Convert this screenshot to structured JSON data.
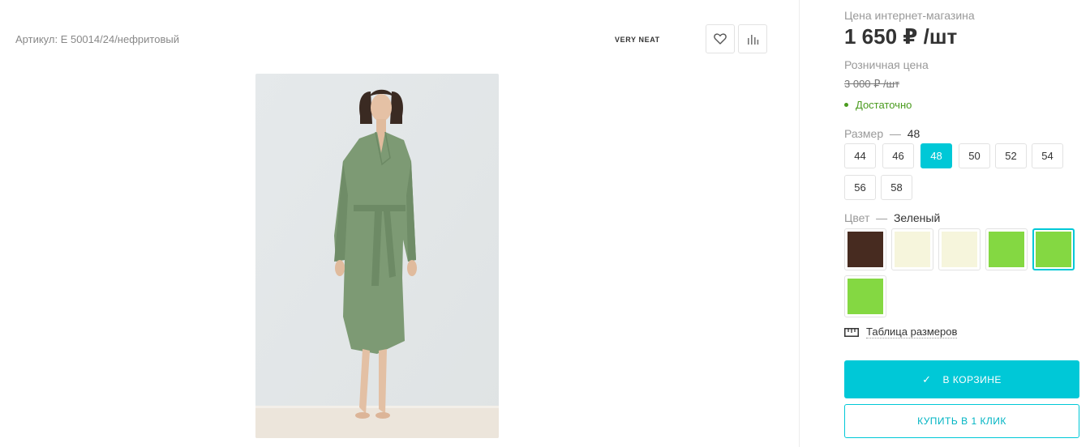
{
  "product": {
    "article": "Артикул: E 50014/24/нефритовый",
    "brand": "VERY NEAT"
  },
  "actions": {
    "favorite_icon": "heart-icon",
    "compare_icon": "bar-chart-icon"
  },
  "pricing": {
    "online_label": "Цена интернет-магазина",
    "online_price": "1 650 ₽ /шт",
    "retail_label": "Розничная цена",
    "retail_price": "3 000 ₽ /шт",
    "stock": "Достаточно",
    "stock_color": "#4a9b1e"
  },
  "size": {
    "label": "Размер",
    "separator": "—",
    "selected": "48",
    "options": [
      "44",
      "46",
      "48",
      "50",
      "52",
      "54",
      "56",
      "58"
    ]
  },
  "color": {
    "label": "Цвет",
    "separator": "—",
    "selected": "Зеленый",
    "swatches": [
      "#472b20",
      "#f6f5dc",
      "#f6f5dc",
      "#84d842",
      "#84d842",
      "#84d842"
    ],
    "selected_index": 4
  },
  "size_table": {
    "label": "Таблица размеров",
    "icon": "ruler-icon"
  },
  "buttons": {
    "in_cart": "В КОРЗИНЕ",
    "buy_one_click": "КУПИТЬ В 1 КЛИК"
  },
  "theme": {
    "accent": "#00c8d7"
  }
}
